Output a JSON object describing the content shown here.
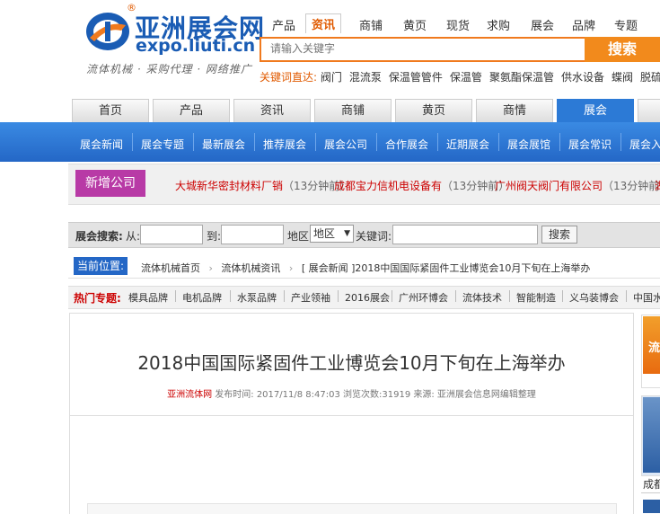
{
  "logo": {
    "reg_mark": "®",
    "title": "亚洲展会网",
    "url": "expo.liuti.cn",
    "slogan": "流体机械 · 采购代理 · 网络推广",
    "icon": "liuti-logo-icon"
  },
  "top_nav": {
    "items": [
      "产品",
      "资讯",
      "商铺",
      "黄页",
      "现货",
      "求购",
      "展会",
      "品牌",
      "专题"
    ],
    "active": "资讯"
  },
  "search": {
    "placeholder": "请输入关键字",
    "button": "搜索"
  },
  "keywords": {
    "label": "关键词直达:",
    "items": [
      "阀门",
      "混流泵",
      "保温管管件",
      "保温管",
      "聚氨酯保温管",
      "供水设备",
      "蝶阀",
      "脱硫脱硝"
    ]
  },
  "main_tabs": {
    "items": [
      "首页",
      "产品",
      "资讯",
      "商铺",
      "黄页",
      "商情",
      "展会"
    ],
    "active": "展会"
  },
  "sub_nav": {
    "items": [
      "展会新闻",
      "展会专题",
      "最新展会",
      "推荐展会",
      "展会公司",
      "合作展会",
      "近期展会",
      "展会展馆",
      "展会常识",
      "展会入场"
    ]
  },
  "new_companies": {
    "label": "新增公司",
    "items": [
      {
        "name": "大城新华密封材料厂销",
        "time": "（13分钟前）"
      },
      {
        "name": "成都宝力信机电设备有",
        "time": "（13分钟前）"
      },
      {
        "name": "广州阀天阀门有限公司",
        "time": "（13分钟前）"
      },
      {
        "name": "湖",
        "time": ""
      }
    ]
  },
  "expo_search": {
    "label": "展会搜索:",
    "from": "从:",
    "to": "到:",
    "region_label": "地区:",
    "region_value": "地区",
    "keyword_label": "关键词:",
    "button": "搜索"
  },
  "breadcrumb": {
    "label": "当前位置:",
    "items": [
      "流体机械首页",
      "流体机械资讯",
      "[ 展会新闻 ]2018中国国际紧固件工业博览会10月下旬在上海举办"
    ]
  },
  "hot_topics": {
    "label": "热门专题:",
    "items": [
      "模具品牌",
      "电机品牌",
      "水泵品牌",
      "产业领袖",
      "2016展会",
      "广州环博会",
      "流体技术",
      "智能制造",
      "义乌装博会",
      "中国水"
    ]
  },
  "article": {
    "title": "2018中国国际紧固件工业博览会10月下旬在上海举办",
    "source": "亚洲流体网",
    "meta": "发布时间: 2017/11/8 8:47:03 浏览次数:31919 来源: 亚洲展会信息网编辑整理"
  },
  "sidebar": {
    "ad1_glyph": "流",
    "ad2_label": "成都"
  },
  "colors": {
    "brand_blue": "#2467c6",
    "accent_orange": "#f28a1c",
    "highlight_red": "#c00000",
    "magenta": "#b83aa6"
  }
}
